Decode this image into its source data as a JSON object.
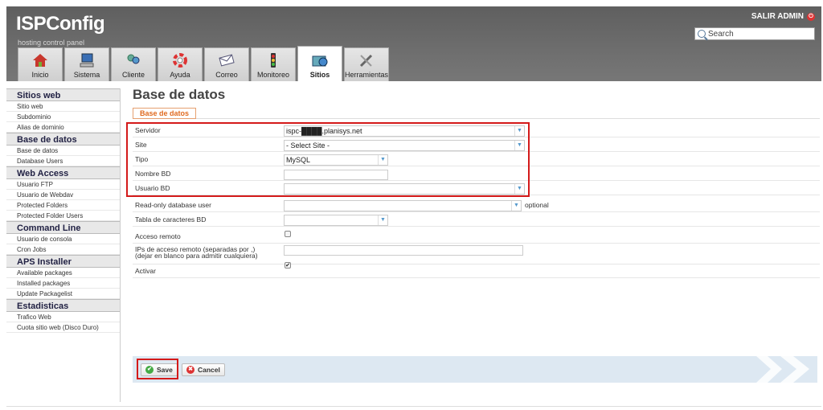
{
  "header": {
    "logo": "ISPConfig",
    "tagline": "hosting control panel",
    "logout_label": "SALIR ADMIN",
    "search_placeholder": "Search"
  },
  "tabs": [
    {
      "label": "Inicio",
      "icon": "home-icon"
    },
    {
      "label": "Sistema",
      "icon": "computer-icon"
    },
    {
      "label": "Cliente",
      "icon": "users-icon"
    },
    {
      "label": "Ayuda",
      "icon": "lifebuoy-icon"
    },
    {
      "label": "Correo",
      "icon": "envelope-icon"
    },
    {
      "label": "Monitoreo",
      "icon": "traffic-light-icon"
    },
    {
      "label": "Sitios",
      "icon": "sites-icon",
      "active": true
    },
    {
      "label": "Herramientas",
      "icon": "tools-icon"
    }
  ],
  "sidebar": {
    "sections": [
      {
        "title": "Sitios web",
        "items": [
          "Sitio web",
          "Subdominio",
          "Alias de dominio"
        ]
      },
      {
        "title": "Base de datos",
        "items": [
          "Base de datos",
          "Database Users"
        ]
      },
      {
        "title": "Web Access",
        "items": [
          "Usuario FTP",
          "Usuario de Webdav",
          "Protected Folders",
          "Protected Folder Users"
        ]
      },
      {
        "title": "Command Line",
        "items": [
          "Usuario de consola",
          "Cron Jobs"
        ]
      },
      {
        "title": "APS Installer",
        "items": [
          "Available packages",
          "Installed packages",
          "Update Packagelist"
        ]
      },
      {
        "title": "Estadisticas",
        "items": [
          "Trafico Web",
          "Cuota sitio web (Disco Duro)"
        ]
      }
    ]
  },
  "main": {
    "title": "Base de datos",
    "subtab": "Base de datos",
    "fields": {
      "servidor": {
        "label": "Servidor",
        "value": "ispc-████.planisys.net"
      },
      "site": {
        "label": "Site",
        "value": "- Select Site -"
      },
      "tipo": {
        "label": "Tipo",
        "value": "MySQL"
      },
      "nombre_bd": {
        "label": "Nombre BD",
        "value": ""
      },
      "usuario_bd": {
        "label": "Usuario BD",
        "value": ""
      },
      "readonly_user": {
        "label": "Read-only database user",
        "value": "",
        "suffix": "optional"
      },
      "charset": {
        "label": "Tabla de caracteres BD",
        "value": ""
      },
      "acceso_remoto": {
        "label": "Acceso remoto",
        "checked": false
      },
      "ips_remoto": {
        "label_line1": "IPs de acceso remoto (separadas por ,)",
        "label_line2": "(dejar en blanco para admitir cualquiera)",
        "value": ""
      },
      "activar": {
        "label": "Activar",
        "checked": true
      }
    },
    "buttons": {
      "save": "Save",
      "cancel": "Cancel"
    }
  },
  "colors": {
    "accent_orange": "#e06a1f",
    "highlight_red": "#d41a1a",
    "header_gray": "#666666"
  }
}
